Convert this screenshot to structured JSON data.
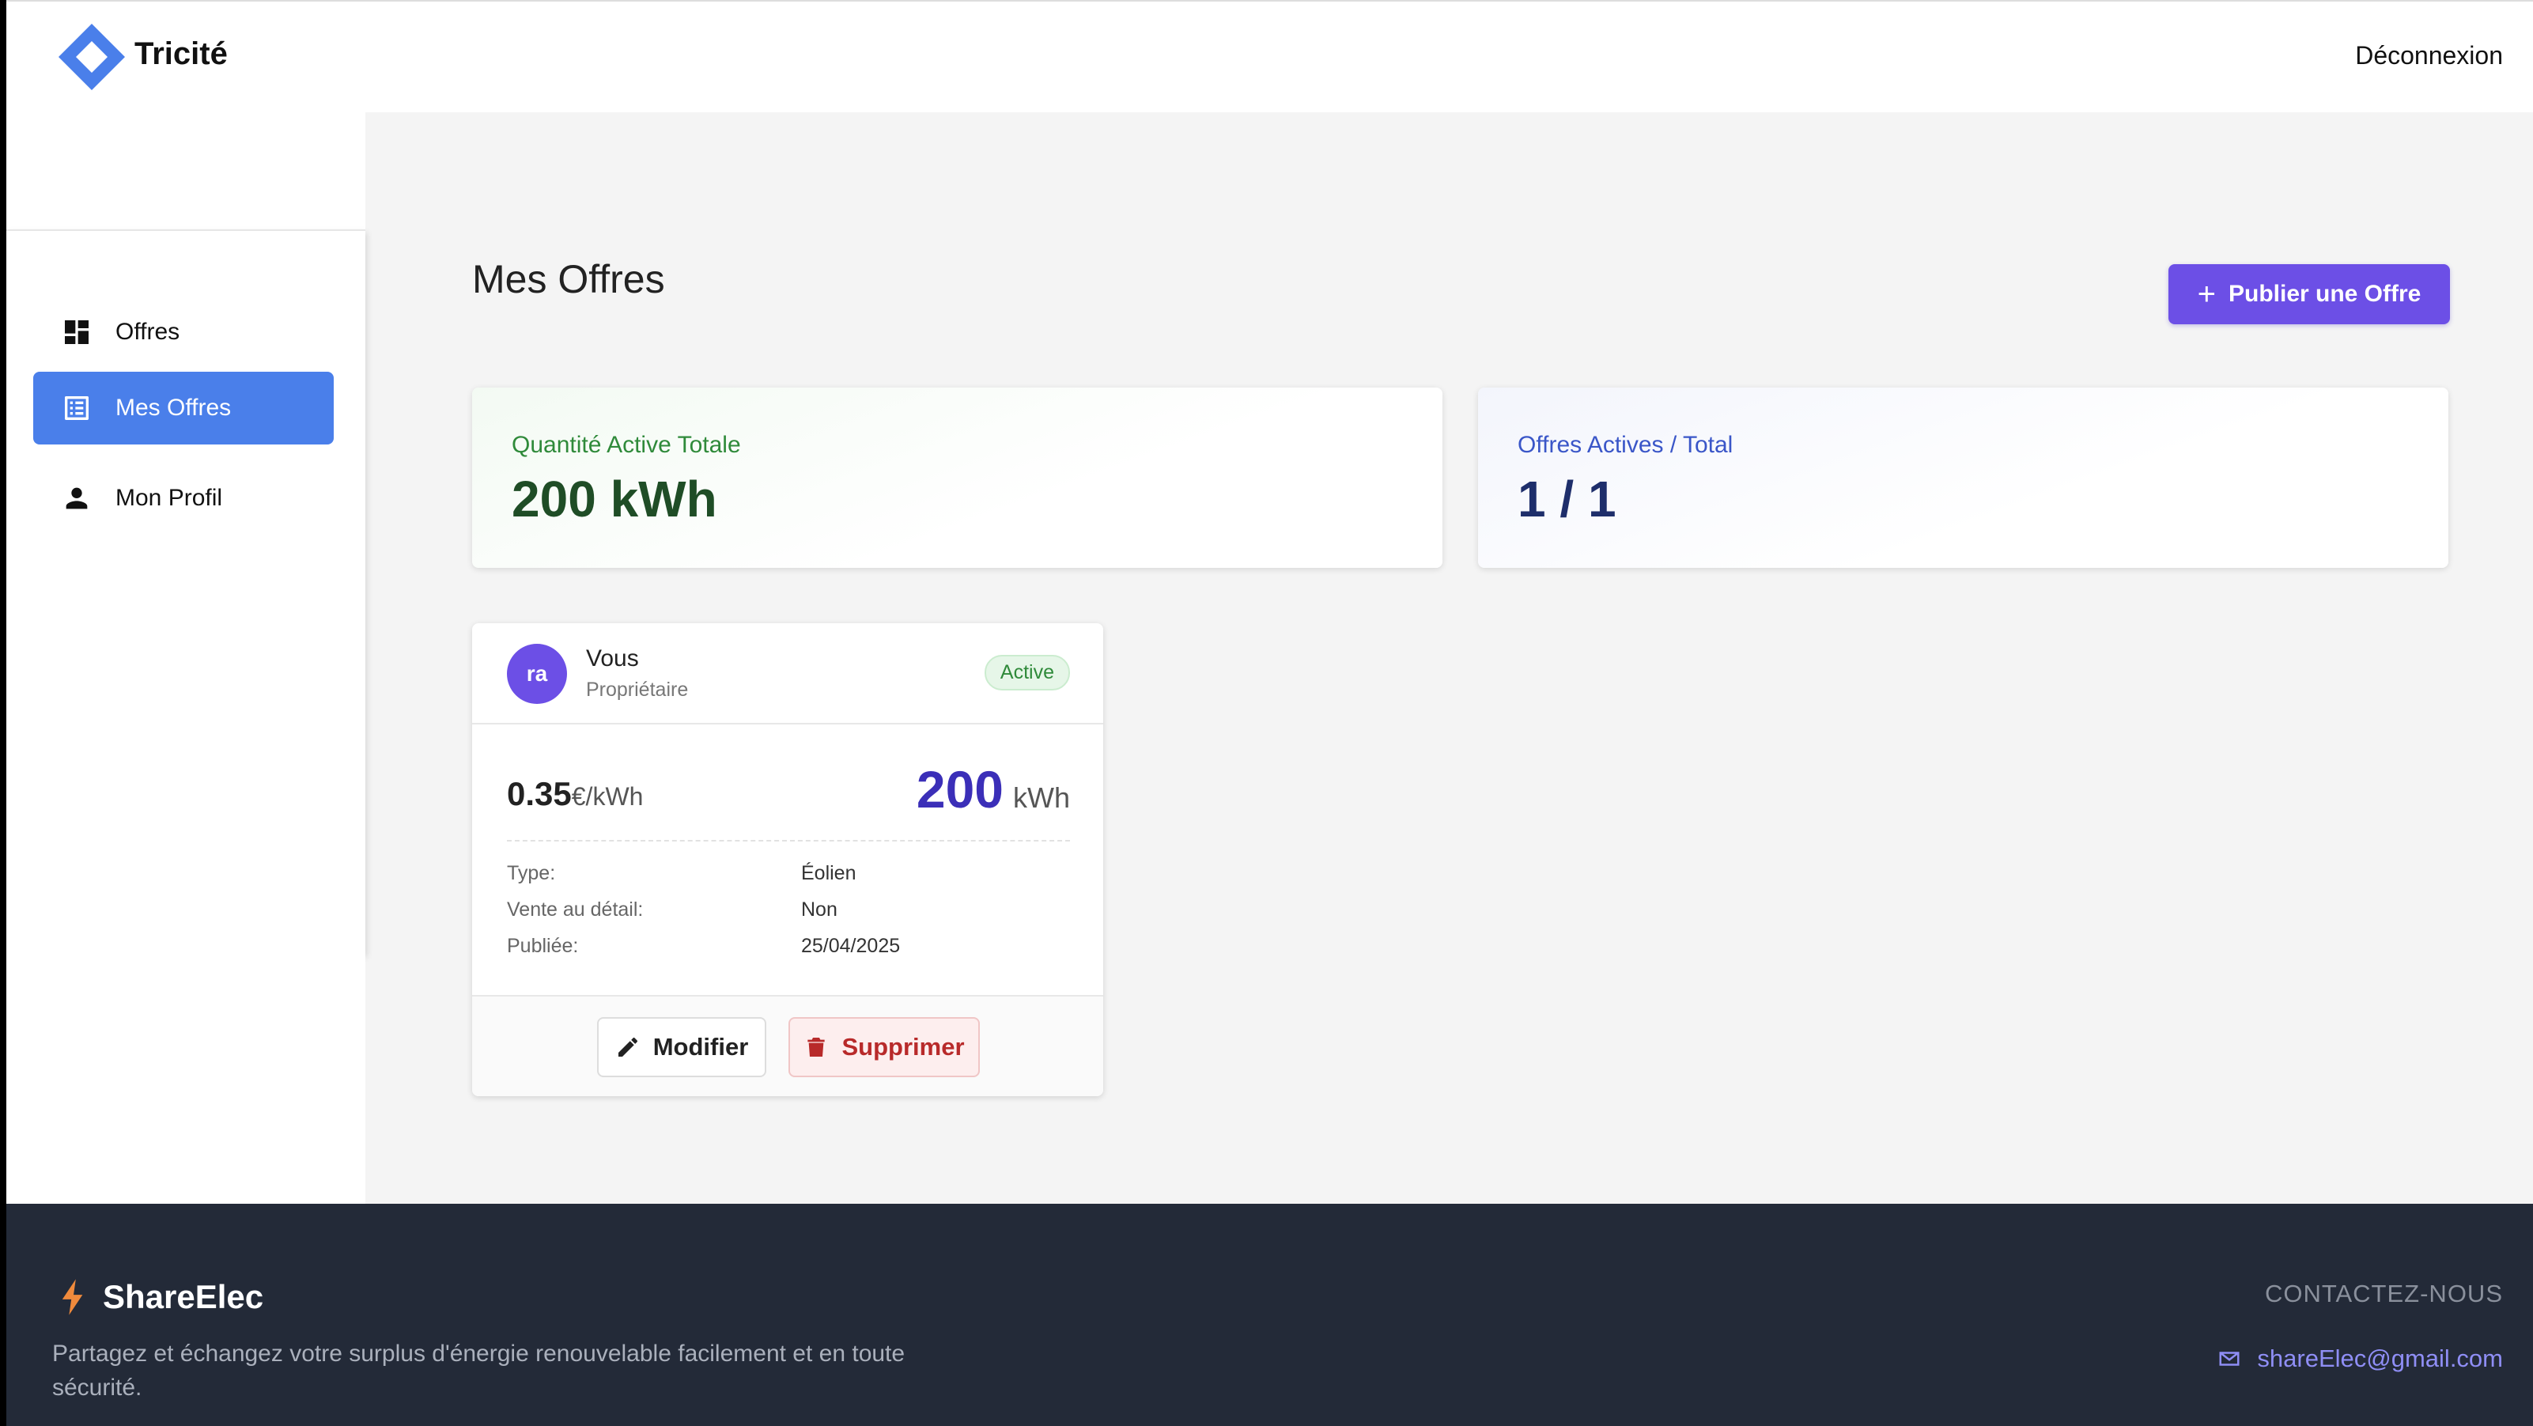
{
  "header": {
    "brand": "Tricité",
    "logout_label": "Déconnexion"
  },
  "sidebar": {
    "items": [
      {
        "label": "Offres",
        "icon": "dashboard-icon",
        "active": false
      },
      {
        "label": "Mes Offres",
        "icon": "list-icon",
        "active": true
      },
      {
        "label": "Mon Profil",
        "icon": "person-icon",
        "active": false
      }
    ]
  },
  "main": {
    "title": "Mes Offres",
    "publish_label": "Publier une Offre",
    "stats": [
      {
        "label": "Quantité Active Totale",
        "value": "200 kWh",
        "accent": "#2f8a3a"
      },
      {
        "label": "Offres Actives / Total",
        "value": "1 / 1",
        "accent": "#3a56c8"
      }
    ],
    "offers": [
      {
        "avatar_initials": "ra",
        "owner_name": "Vous",
        "owner_role": "Propriétaire",
        "status": "Active",
        "price": "0.35",
        "price_unit": "€/kWh",
        "quantity": "200",
        "quantity_unit": "kWh",
        "details": [
          {
            "key": "Type:",
            "value": "Éolien"
          },
          {
            "key": "Vente au détail:",
            "value": "Non"
          },
          {
            "key": "Publiée:",
            "value": "25/04/2025"
          }
        ],
        "edit_label": "Modifier",
        "delete_label": "Supprimer"
      }
    ]
  },
  "footer": {
    "brand": "ShareElec",
    "description": "Partagez et échangez votre surplus d'énergie renouvelable facilement et en toute sécurité.",
    "contact_title": "CONTACTEZ-NOUS",
    "email": "shareElec@gmail.com"
  },
  "colors": {
    "primary": "#6c4fe6",
    "nav_active": "#4a7fea",
    "logo": "#4a7fea",
    "footer_bg": "#232a38"
  }
}
